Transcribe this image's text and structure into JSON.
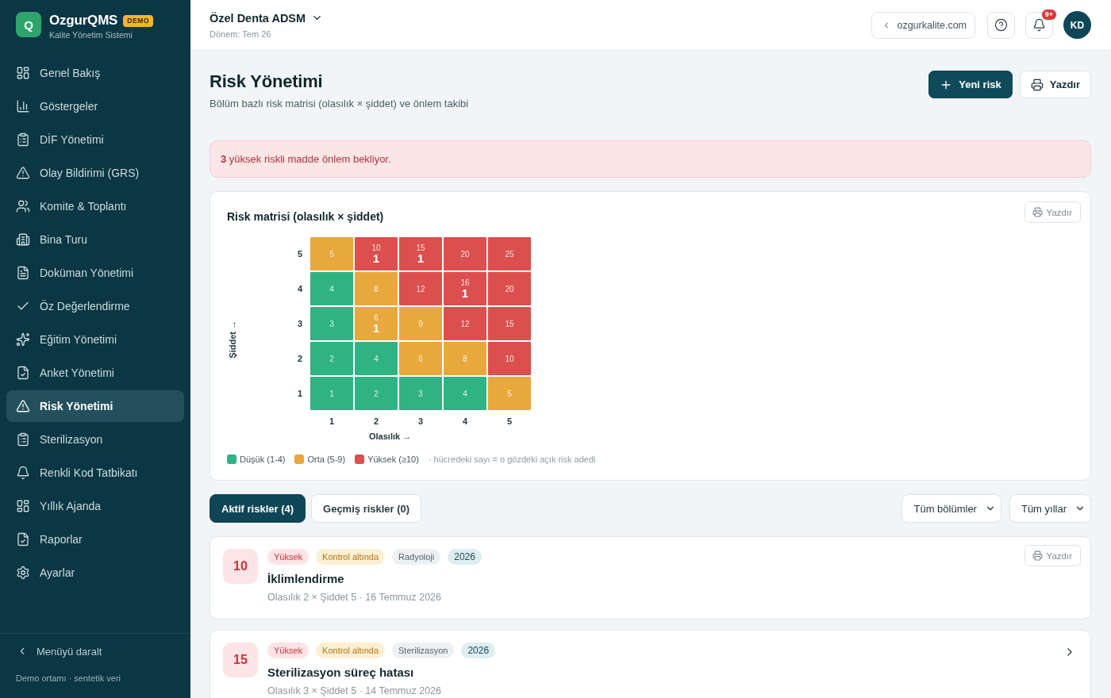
{
  "sidebar": {
    "logo": {
      "letter": "Q",
      "name": "OzgurQMS",
      "badge": "DEMO",
      "subtitle": "Kalite Yönetim Sistemi"
    },
    "items": [
      {
        "label": "Genel Bakış",
        "selected": false
      },
      {
        "label": "Göstergeler",
        "selected": false
      },
      {
        "label": "DİF Yönetimi",
        "selected": false
      },
      {
        "label": "Olay Bildirimi (GRS)",
        "selected": false
      },
      {
        "label": "Komite & Toplantı",
        "selected": false
      },
      {
        "label": "Bina Turu",
        "selected": false
      },
      {
        "label": "Doküman Yönetimi",
        "selected": false
      },
      {
        "label": "Öz Değerlendirme",
        "selected": false
      },
      {
        "label": "Eğitim Yönetimi",
        "selected": false
      },
      {
        "label": "Anket Yönetimi",
        "selected": false
      },
      {
        "label": "Risk Yönetimi",
        "selected": true
      },
      {
        "label": "Sterilizasyon",
        "selected": false
      },
      {
        "label": "Renkli Kod Tatbikatı",
        "selected": false
      },
      {
        "label": "Yıllık Ajanda",
        "selected": false
      },
      {
        "label": "Raporlar",
        "selected": false
      },
      {
        "label": "Ayarlar",
        "selected": false
      }
    ],
    "collapse": "Menüyü daralt",
    "footer": "Demo ortamı · sentetik veri"
  },
  "header": {
    "organization": "Özel Denta ADSM",
    "period": "Dönem: Tem 26",
    "site_link": "ozgurkalite.com",
    "notification_badge": "9+",
    "avatar": "KD"
  },
  "page": {
    "title": "Risk Yönetimi",
    "subtitle": "Bölüm bazlı risk matrisi (olasılık × şiddet) ve önlem takibi",
    "actions": [
      {
        "label": "Yeni risk",
        "kind": "primary"
      },
      {
        "label": "Yazdır",
        "kind": "print"
      }
    ]
  },
  "alert": "**3** yüksek riskli madde önlem bekliyor.",
  "matrix": {
    "title": "Risk matrisi (olasılık × şiddet)",
    "print": "Yazdır",
    "y_label": "Şiddet →",
    "x_label": "Olasılık →",
    "rows": [
      {
        "label": "5",
        "cells": [
          {
            "score": "5",
            "color": "#e8a83c"
          },
          {
            "score": "10",
            "count": "1",
            "color": "#dc4f4f"
          },
          {
            "score": "15",
            "count": "1",
            "color": "#dc4f4f"
          },
          {
            "score": "20",
            "color": "#dc4f4f"
          },
          {
            "score": "25",
            "color": "#dc4f4f"
          }
        ]
      },
      {
        "label": "4",
        "cells": [
          {
            "score": "4",
            "color": "#2fb384"
          },
          {
            "score": "8",
            "color": "#e8a83c"
          },
          {
            "score": "12",
            "color": "#dc4f4f"
          },
          {
            "score": "16",
            "count": "1",
            "color": "#dc4f4f"
          },
          {
            "score": "20",
            "color": "#dc4f4f"
          }
        ]
      },
      {
        "label": "3",
        "cells": [
          {
            "score": "3",
            "color": "#2fb384"
          },
          {
            "score": "6",
            "count": "1",
            "color": "#e8a83c"
          },
          {
            "score": "9",
            "color": "#e8a83c"
          },
          {
            "score": "12",
            "color": "#dc4f4f"
          },
          {
            "score": "15",
            "color": "#dc4f4f"
          }
        ]
      },
      {
        "label": "2",
        "cells": [
          {
            "score": "2",
            "color": "#2fb384"
          },
          {
            "score": "4",
            "color": "#2fb384"
          },
          {
            "score": "6",
            "color": "#e8a83c"
          },
          {
            "score": "8",
            "color": "#e8a83c"
          },
          {
            "score": "10",
            "color": "#dc4f4f"
          }
        ]
      },
      {
        "label": "1",
        "cells": [
          {
            "score": "1",
            "color": "#2fb384"
          },
          {
            "score": "2",
            "color": "#2fb384"
          },
          {
            "score": "3",
            "color": "#2fb384"
          },
          {
            "score": "4",
            "color": "#2fb384"
          },
          {
            "score": "5",
            "color": "#e8a83c"
          }
        ]
      }
    ],
    "x_ticks": [
      "1",
      "2",
      "3",
      "4",
      "5"
    ],
    "legend": [
      {
        "label": "Düşük (1-4)",
        "color": "#2fb384"
      },
      {
        "label": "Orta (5-9)",
        "color": "#e8a83c"
      },
      {
        "label": "Yüksek (≥10)",
        "color": "#dc4f4f"
      }
    ],
    "note": "· hücredeki sayı = o gözdeki açık risk adedi"
  },
  "tabs": [
    {
      "label": "Aktif riskler (4)",
      "selected": true
    },
    {
      "label": "Geçmiş riskler (0)",
      "selected": false
    }
  ],
  "filters": [
    "Tüm bölümler",
    "Tüm yıllar"
  ],
  "risks": [
    {
      "score": "10",
      "tags": [
        {
          "label": "Yüksek",
          "kind": "severity"
        },
        {
          "label": "Kontrol altında",
          "kind": "status"
        },
        {
          "label": "Radyoloji",
          "kind": "department"
        },
        {
          "label": "2026",
          "kind": "year"
        }
      ],
      "title": "İklimlendirme",
      "meta": "Olasılık 2 × Şiddet 5 · 16 Temmuz 2026",
      "kind": "print",
      "button": "Yazdır"
    },
    {
      "score": "15",
      "tags": [
        {
          "label": "Yüksek",
          "kind": "severity"
        },
        {
          "label": "Kontrol altında",
          "kind": "status"
        },
        {
          "label": "Sterilizasyon",
          "kind": "department"
        },
        {
          "label": "2026",
          "kind": "year"
        }
      ],
      "title": "Sterilizasyon süreç hatası",
      "meta": "Olasılık 3 × Şiddet 5 · 14 Temmuz 2026",
      "kind": "link"
    }
  ]
}
